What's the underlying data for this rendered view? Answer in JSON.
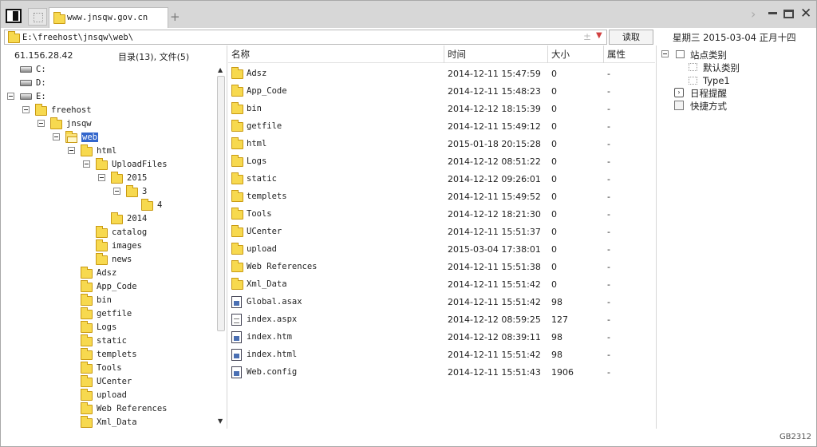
{
  "tab": {
    "title": "www.jnsqw.gov.cn"
  },
  "address": {
    "path": "E:\\freehost\\jnsqw\\web\\"
  },
  "toolbar": {
    "read_label": "读取",
    "date_text": "星期三  2015-03-04  正月十四"
  },
  "left": {
    "ip": "61.156.28.42",
    "dir_count": "目录(13), 文件(5)",
    "tree": [
      {
        "label": "C:",
        "kind": "drive",
        "level": 0,
        "expand": false
      },
      {
        "label": "D:",
        "kind": "drive",
        "level": 0,
        "expand": false
      },
      {
        "label": "E:",
        "kind": "drive",
        "level": 0,
        "expand": true
      },
      {
        "label": "freehost",
        "kind": "folder",
        "level": 1,
        "expand": true
      },
      {
        "label": "jnsqw",
        "kind": "folder",
        "level": 2,
        "expand": true
      },
      {
        "label": "web",
        "kind": "folder-open",
        "level": 3,
        "expand": true,
        "selected": true
      },
      {
        "label": "html",
        "kind": "folder",
        "level": 4,
        "expand": true
      },
      {
        "label": "UploadFiles",
        "kind": "folder",
        "level": 5,
        "expand": true
      },
      {
        "label": "2015",
        "kind": "folder",
        "level": 6,
        "expand": true
      },
      {
        "label": "3",
        "kind": "folder",
        "level": 7,
        "expand": true
      },
      {
        "label": "4",
        "kind": "folder",
        "level": 8,
        "expand": false
      },
      {
        "label": "2014",
        "kind": "folder",
        "level": 6,
        "expand": false
      },
      {
        "label": "catalog",
        "kind": "folder",
        "level": 5,
        "expand": false
      },
      {
        "label": "images",
        "kind": "folder",
        "level": 5,
        "expand": false
      },
      {
        "label": "news",
        "kind": "folder",
        "level": 5,
        "expand": false
      },
      {
        "label": "Adsz",
        "kind": "folder",
        "level": 4,
        "expand": false
      },
      {
        "label": "App_Code",
        "kind": "folder",
        "level": 4,
        "expand": false
      },
      {
        "label": "bin",
        "kind": "folder",
        "level": 4,
        "expand": false
      },
      {
        "label": "getfile",
        "kind": "folder",
        "level": 4,
        "expand": false
      },
      {
        "label": "Logs",
        "kind": "folder",
        "level": 4,
        "expand": false
      },
      {
        "label": "static",
        "kind": "folder",
        "level": 4,
        "expand": false
      },
      {
        "label": "templets",
        "kind": "folder",
        "level": 4,
        "expand": false
      },
      {
        "label": "Tools",
        "kind": "folder",
        "level": 4,
        "expand": false
      },
      {
        "label": "UCenter",
        "kind": "folder",
        "level": 4,
        "expand": false
      },
      {
        "label": "upload",
        "kind": "folder",
        "level": 4,
        "expand": false
      },
      {
        "label": "Web References",
        "kind": "folder",
        "level": 4,
        "expand": false
      },
      {
        "label": "Xml_Data",
        "kind": "folder",
        "level": 4,
        "expand": false
      }
    ]
  },
  "files": {
    "headers": {
      "name": "名称",
      "time": "时间",
      "size": "大小",
      "attr": "属性"
    },
    "rows": [
      {
        "name": "Adsz",
        "time": "2014-12-11 15:47:59",
        "size": "0",
        "attr": "-",
        "type": "folder"
      },
      {
        "name": "App_Code",
        "time": "2014-12-11 15:48:23",
        "size": "0",
        "attr": "-",
        "type": "folder"
      },
      {
        "name": "bin",
        "time": "2014-12-12 18:15:39",
        "size": "0",
        "attr": "-",
        "type": "folder"
      },
      {
        "name": "getfile",
        "time": "2014-12-11 15:49:12",
        "size": "0",
        "attr": "-",
        "type": "folder"
      },
      {
        "name": "html",
        "time": "2015-01-18 20:15:28",
        "size": "0",
        "attr": "-",
        "type": "folder"
      },
      {
        "name": "Logs",
        "time": "2014-12-12 08:51:22",
        "size": "0",
        "attr": "-",
        "type": "folder"
      },
      {
        "name": "static",
        "time": "2014-12-12 09:26:01",
        "size": "0",
        "attr": "-",
        "type": "folder"
      },
      {
        "name": "templets",
        "time": "2014-12-11 15:49:52",
        "size": "0",
        "attr": "-",
        "type": "folder"
      },
      {
        "name": "Tools",
        "time": "2014-12-12 18:21:30",
        "size": "0",
        "attr": "-",
        "type": "folder"
      },
      {
        "name": "UCenter",
        "time": "2014-12-11 15:51:37",
        "size": "0",
        "attr": "-",
        "type": "folder"
      },
      {
        "name": "upload",
        "time": "2015-03-04 17:38:01",
        "size": "0",
        "attr": "-",
        "type": "folder"
      },
      {
        "name": "Web References",
        "time": "2014-12-11 15:51:38",
        "size": "0",
        "attr": "-",
        "type": "folder"
      },
      {
        "name": "Xml_Data",
        "time": "2014-12-11 15:51:42",
        "size": "0",
        "attr": "-",
        "type": "folder"
      },
      {
        "name": "Global.asax",
        "time": "2014-12-11 15:51:42",
        "size": "98",
        "attr": "-",
        "type": "file"
      },
      {
        "name": "index.aspx",
        "time": "2014-12-12 08:59:25",
        "size": "127",
        "attr": "-",
        "type": "file-aspx"
      },
      {
        "name": "index.htm",
        "time": "2014-12-12 08:39:11",
        "size": "98",
        "attr": "-",
        "type": "file"
      },
      {
        "name": "index.html",
        "time": "2014-12-11 15:51:42",
        "size": "98",
        "attr": "-",
        "type": "file"
      },
      {
        "name": "Web.config",
        "time": "2014-12-11 15:51:43",
        "size": "1906",
        "attr": "-",
        "type": "file"
      }
    ]
  },
  "right": {
    "category": "站点类别",
    "sub": [
      "默认类别",
      "Type1"
    ],
    "schedule": "日程提醒",
    "shortcuts": "快捷方式"
  },
  "status": {
    "text": "GB2312"
  },
  "colors": {
    "selection": "#3366cc",
    "folder": "#f7d94f"
  }
}
